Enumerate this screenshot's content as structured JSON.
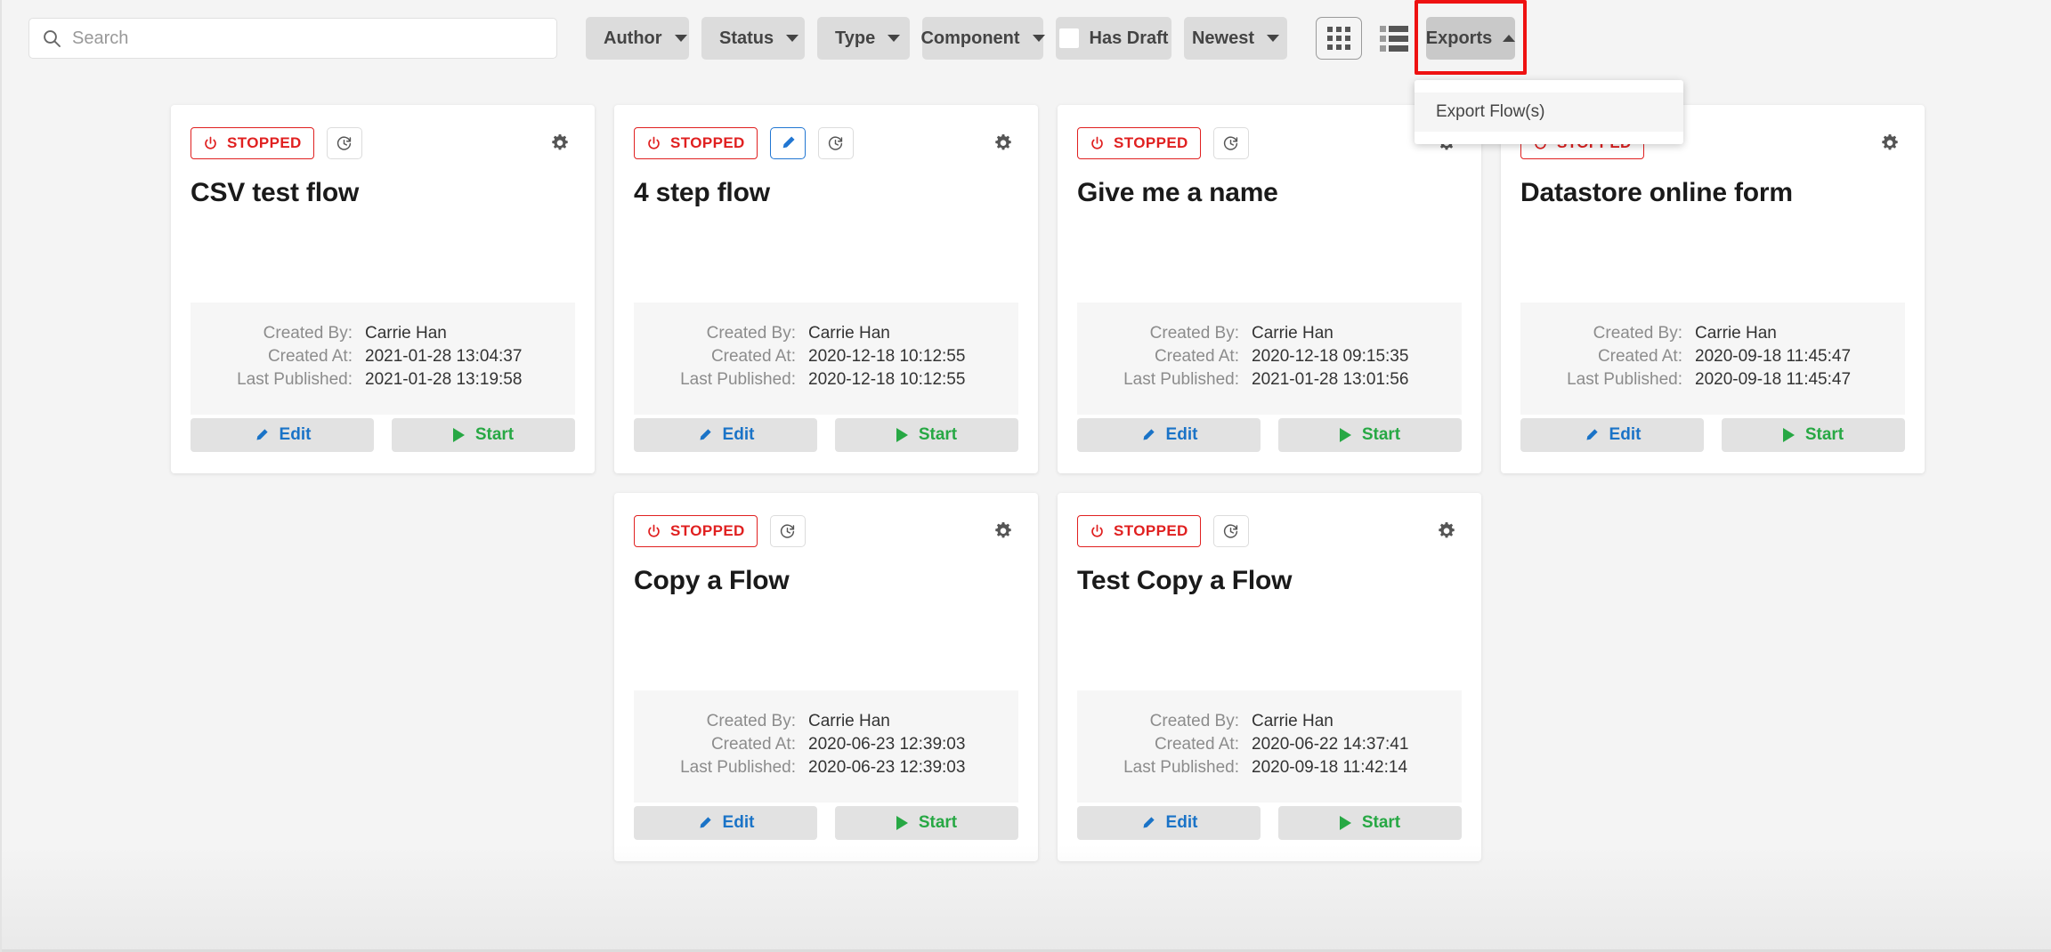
{
  "toolbar": {
    "search": {
      "placeholder": "Search",
      "value": ""
    },
    "search_icon": "search-icon",
    "filters": [
      {
        "label": "Author",
        "icon": "chevron-down-icon"
      },
      {
        "label": "Status",
        "icon": "chevron-down-icon"
      },
      {
        "label": "Type",
        "icon": "chevron-down-icon"
      },
      {
        "label": "Component",
        "icon": "chevron-down-icon"
      }
    ],
    "has_draft": {
      "label": "Has Draft",
      "checked": false
    },
    "sort": {
      "label": "Newest",
      "icon": "chevron-down-icon"
    },
    "views": [
      {
        "name": "grid-view-icon",
        "active": true
      },
      {
        "name": "list-view-icon",
        "active": false
      }
    ],
    "exports": {
      "label": "Exports",
      "icon": "chevron-up-icon",
      "expanded": true,
      "highlight_color": "#ee1111",
      "menu": [
        {
          "label": "Export Flow(s)"
        }
      ]
    }
  },
  "labels": {
    "created_by": "Created By:",
    "created_at": "Created At:",
    "last_published": "Last Published:",
    "edit": "Edit",
    "start": "Start",
    "status_stopped": "STOPPED"
  },
  "colors": {
    "stopped": "#e02020",
    "edit": "#1a73c7",
    "start": "#27a844",
    "draft": "#2176d2",
    "annotation": "#ee1111"
  },
  "cards": [
    {
      "title": "CSV test flow",
      "status": "STOPPED",
      "has_draft": false,
      "created_by": "Carrie Han",
      "created_at": "2021-01-28 13:04:37",
      "last_published": "2021-01-28 13:19:58"
    },
    {
      "title": "4 step flow",
      "status": "STOPPED",
      "has_draft": true,
      "created_by": "Carrie Han",
      "created_at": "2020-12-18 10:12:55",
      "last_published": "2020-12-18 10:12:55"
    },
    {
      "title": "Give me a name",
      "status": "STOPPED",
      "has_draft": false,
      "created_by": "Carrie Han",
      "created_at": "2020-12-18 09:15:35",
      "last_published": "2021-01-28 13:01:56"
    },
    {
      "title": "Datastore online form",
      "status": "STOPPED",
      "has_draft": false,
      "created_by": "Carrie Han",
      "created_at": "2020-09-18 11:45:47",
      "last_published": "2020-09-18 11:45:47"
    },
    {
      "title": "Copy a Flow",
      "status": "STOPPED",
      "has_draft": false,
      "created_by": "Carrie Han",
      "created_at": "2020-06-23 12:39:03",
      "last_published": "2020-06-23 12:39:03"
    },
    {
      "title": "Test Copy a Flow",
      "status": "STOPPED",
      "has_draft": false,
      "created_by": "Carrie Han",
      "created_at": "2020-06-22 14:37:41",
      "last_published": "2020-09-18 11:42:14"
    }
  ]
}
